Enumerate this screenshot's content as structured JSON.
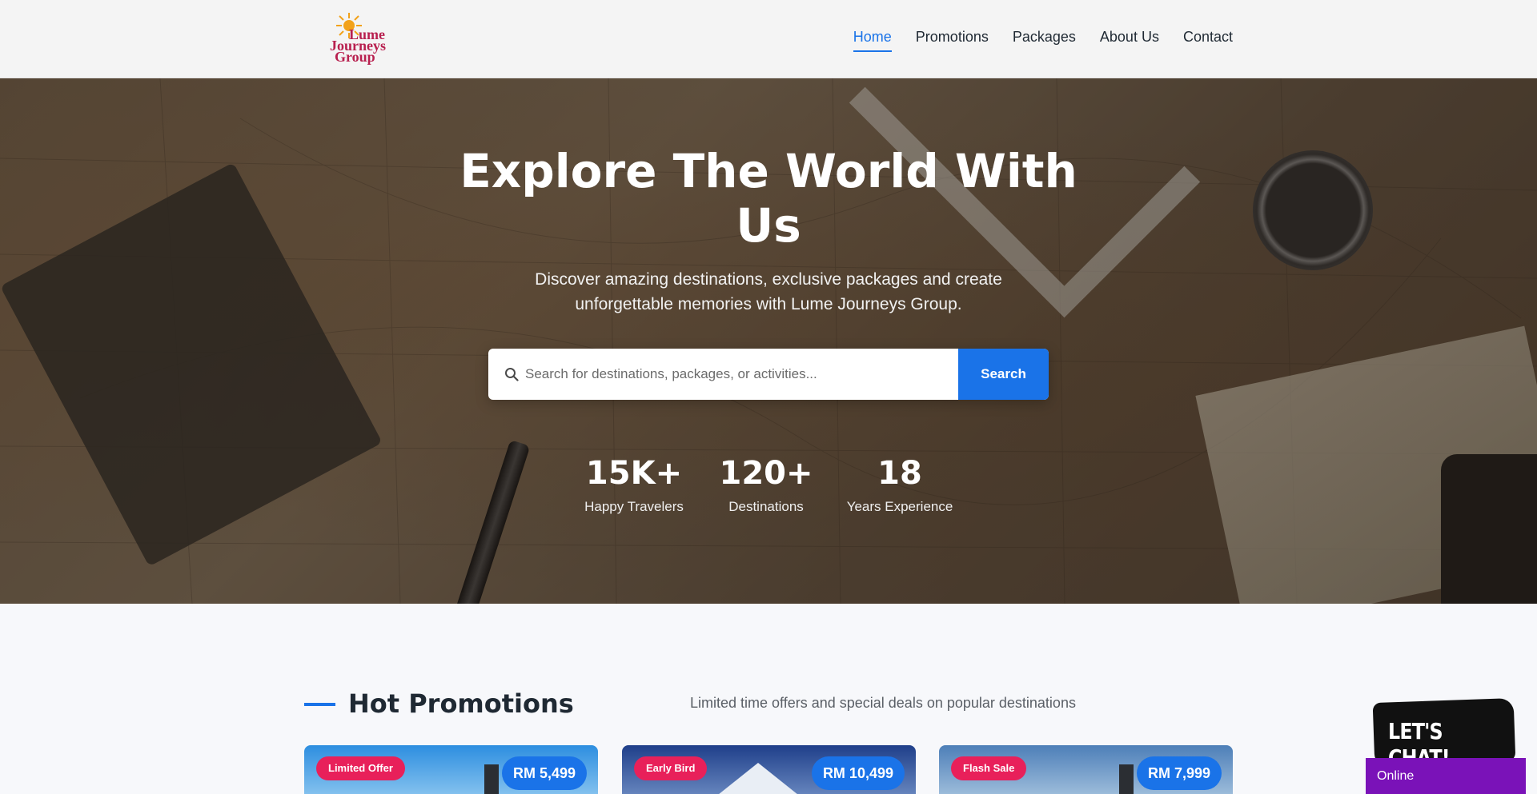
{
  "logo": {
    "line1": "Lume",
    "line2": "Journeys",
    "line3": "Group"
  },
  "nav": {
    "items": [
      {
        "label": "Home",
        "active": true
      },
      {
        "label": "Promotions"
      },
      {
        "label": "Packages"
      },
      {
        "label": "About Us"
      },
      {
        "label": "Contact"
      }
    ]
  },
  "hero": {
    "title": "Explore The World With Us",
    "subtitle": "Discover amazing destinations, exclusive packages and create unforgettable memories with Lume Journeys Group.",
    "search": {
      "placeholder": "Search for destinations, packages, or activities...",
      "value": "",
      "button_label": "Search",
      "icon": "search-icon"
    },
    "stats": [
      {
        "value": "15K+",
        "label": "Happy Travelers"
      },
      {
        "value": "120+",
        "label": "Destinations"
      },
      {
        "value": "18",
        "label": "Years Experience"
      }
    ]
  },
  "promotions": {
    "title": "Hot Promotions",
    "subtitle": "Limited time offers and special deals on popular destinations",
    "cards": [
      {
        "badge": "Limited Offer",
        "price": "RM 5,499"
      },
      {
        "badge": "Early Bird",
        "price": "RM 10,499"
      },
      {
        "badge": "Flash Sale",
        "price": "RM 7,999"
      }
    ]
  },
  "chat": {
    "bubble_text": "LET'S CHAT!",
    "status": "Online"
  },
  "colors": {
    "accent": "#1a73e8",
    "badge": "#e8205a",
    "chat_status": "#7a12b8",
    "logo": "#b8204f"
  }
}
